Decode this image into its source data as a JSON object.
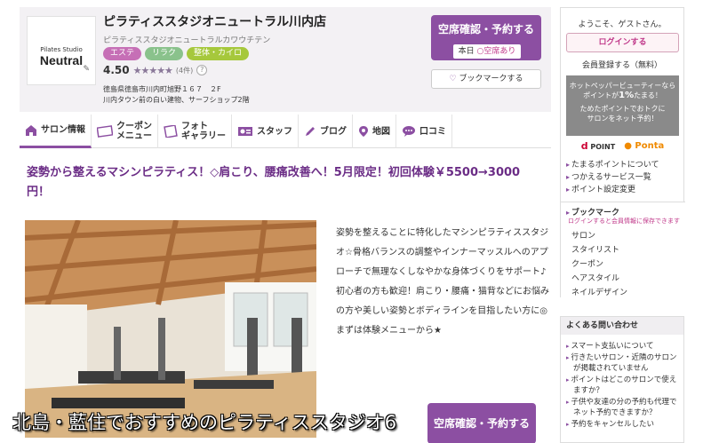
{
  "salon": {
    "logo_line1": "Pilates Studio",
    "logo_line2": "Neutral",
    "name": "ピラティススタジオニュートラル川内店",
    "kana": "ピラティススタジオニュートラルカワウチテン",
    "tags": [
      "エステ",
      "リラク",
      "整体・カイロ"
    ],
    "score": "4.50",
    "stars": "★★★★★",
    "review_count": "(4件)",
    "help": "?",
    "address_line1": "徳島県徳島市川内町旭野１６７　２F",
    "address_line2": "川内タウン前の白い建物、サーフショップ2階",
    "reserve_label": "空席確認・予約する",
    "today_label": "本日",
    "availability": "空席あり",
    "bookmark_label": "ブックマークする"
  },
  "tabs": [
    {
      "label": "サロン情報",
      "icon": "home-icon"
    },
    {
      "label": "クーポン\nメニュー",
      "icon": "coupon-icon"
    },
    {
      "label": "フォト\nギャラリー",
      "icon": "photo-icon"
    },
    {
      "label": "スタッフ",
      "icon": "staff-icon"
    },
    {
      "label": "ブログ",
      "icon": "pen-icon"
    },
    {
      "label": "地図",
      "icon": "map-pin-icon"
    },
    {
      "label": "口コミ",
      "icon": "speech-bubble-icon"
    }
  ],
  "content": {
    "headline": "姿勢から整えるマシンピラティス！◇肩こり、腰痛改善へ！5月限定！初回体験￥5500→3000円！",
    "description": "姿勢を整えることに特化したマシンピラティススタジオ☆骨格バランスの調整やインナーマッスルへのアプローチで無理なくしなやかな身体づくりをサポート♪初心者の方も歓迎！肩こり・腰痛・猫背などにお悩みの方や美しい姿勢とボディラインを目指したい方に◎まずは体験メニューから★",
    "reserve_label": "空席確認・予約する"
  },
  "caption": "北島・藍住でおすすめのピラティススタジオ6",
  "sidebar": {
    "welcome": "ようこそ、ゲストさん。",
    "login": "ログインする",
    "register": "会員登録する（無料）",
    "hpb_line1": "ホットペッパービューティーなら",
    "hpb_line2a": "ポイントが",
    "hpb_pct": "1%",
    "hpb_line2b": "たまる！",
    "hpb_line3": "ためたポイントでおトクに",
    "hpb_line4": "サロンをネット予約！",
    "dpoint": "POINT",
    "ponta": "Ponta",
    "point_links": [
      "たまるポイントについて",
      "つかえるサービス一覧",
      "ポイント設定変更"
    ],
    "bookmark_head": "ブックマーク",
    "bookmark_note": "ログインすると会員情報に保存できます",
    "bookmark_links": [
      "サロン",
      "スタイリスト",
      "クーポン",
      "ヘアスタイル",
      "ネイルデザイン"
    ],
    "faq_head": "よくある問い合わせ",
    "faq_links": [
      "スマート支払いについて",
      "行きたいサロン・近隣のサロンが掲載されていません",
      "ポイントはどこのサロンで使えますか？",
      "子供や友達の分の予約も代理でネット予約できますか？",
      "予約をキャンセルしたい"
    ]
  },
  "colors": {
    "accent": "#8c4fa2",
    "pink": "#c0398a"
  }
}
